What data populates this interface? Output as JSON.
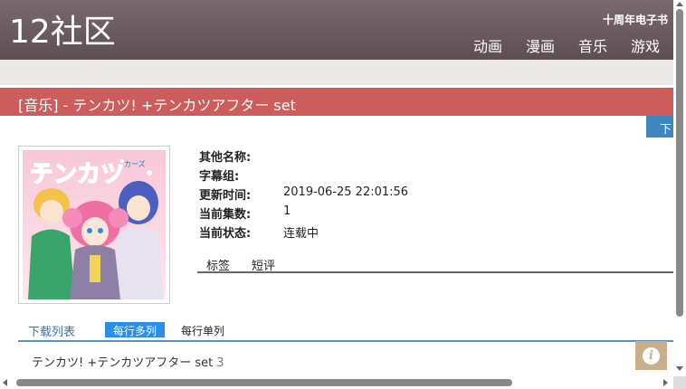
{
  "header": {
    "logo": "12社区",
    "top_link": "十周年电子书",
    "nav": [
      "动画",
      "漫画",
      "音乐",
      "游戏"
    ]
  },
  "title_bar": {
    "title": "[音乐] - テンカツ! +テンカツアフター set"
  },
  "download_tab": "下",
  "cover": {
    "logo_text": "テンカツ",
    "logo_sub": "カーズ"
  },
  "info": [
    {
      "label": "其他名称:",
      "value": ""
    },
    {
      "label": "字幕组:",
      "value": ""
    },
    {
      "label": "更新时间:",
      "value": "2019-06-25 22:01:56"
    },
    {
      "label": "当前集数:",
      "value": "1"
    },
    {
      "label": "当前状态:",
      "value": "连载中"
    }
  ],
  "sub_tabs": [
    "标签",
    "短评"
  ],
  "download_list": {
    "title": "下载列表",
    "mode_active": "每行多列",
    "mode_inactive": "每行单列",
    "files": [
      {
        "name": "テンカツ! +テンカツアフター set",
        "count": "3"
      }
    ]
  },
  "colors": {
    "header": "#6b5b61",
    "title_bar": "#cd5c5c",
    "accent_blue": "#2b8ee8"
  },
  "icons": [
    "info-icon",
    "scroll-up-icon",
    "scroll-down-icon",
    "scroll-left-icon",
    "scroll-right-icon"
  ]
}
